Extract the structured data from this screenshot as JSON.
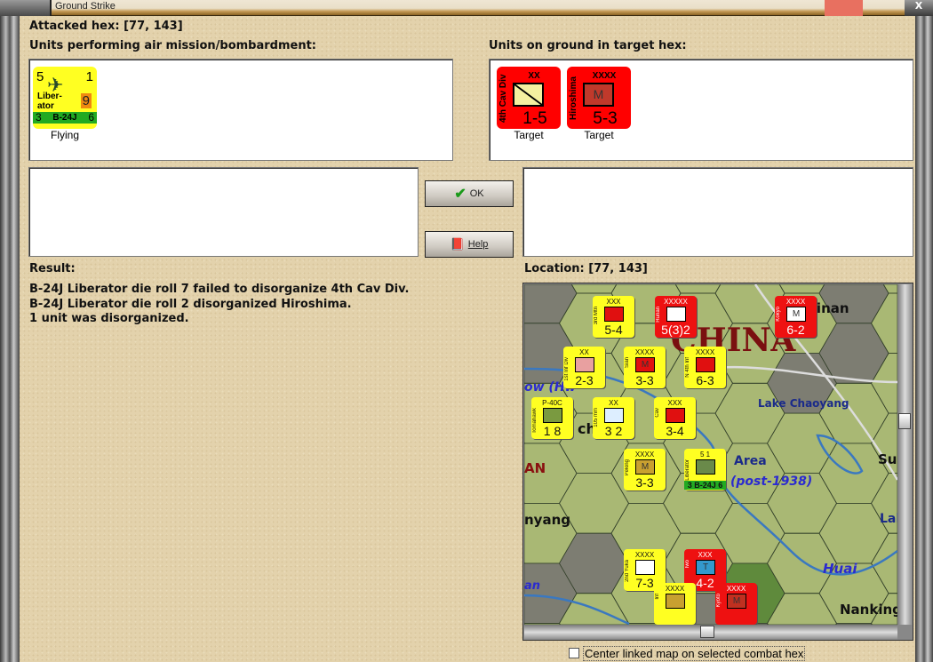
{
  "window": {
    "title": "Ground Strike",
    "close": "X"
  },
  "attacked_hex": "Attacked hex:  [77, 143]",
  "air_units": {
    "label": "Units performing air mission/bombardment:",
    "units": [
      {
        "top_left": "5",
        "top_right": "1",
        "name": "Liber-\nator",
        "value": "9",
        "bottom_left": "3",
        "type": "B-24J",
        "bottom_right": "6",
        "status": "Flying"
      }
    ]
  },
  "ground_units": {
    "label": "Units on ground in target hex:",
    "units": [
      {
        "size": "XX",
        "name": "4th Cav Div",
        "strength": "1-5",
        "status": "Target"
      },
      {
        "size": "XXXX",
        "name": "Hiroshima",
        "symbol": "M",
        "strength": "5-3",
        "status": "Target"
      }
    ]
  },
  "buttons": {
    "ok": "OK",
    "help": "Help"
  },
  "result": {
    "label": "Result:",
    "lines": [
      "B-24J Liberator die roll 7 failed to disorganize 4th Cav Div.",
      "B-24J Liberator die roll 2 disorganized Hiroshima.",
      "1 unit was disorganized."
    ]
  },
  "location": {
    "label": "Location:  [77, 143]"
  },
  "map": {
    "labels": [
      "CHINA",
      "sinan",
      "Lake Chaoyang",
      "Area",
      "v (post-1938)",
      "ow (Hw",
      "ch",
      "AN",
      "nyang",
      "Su",
      "Lak",
      "Huai",
      "an",
      "Nanking"
    ],
    "counters": [
      {
        "size": "XXX",
        "name": "3rd Mtn",
        "strength": "5-4",
        "color": "#ffff22",
        "sym": "#e01010"
      },
      {
        "size": "XXXXX",
        "name": "Hunan",
        "strength": "5(3)2",
        "color": "#ee1111",
        "sym": "#ffffff"
      },
      {
        "size": "XXXX",
        "name": "Kokyo",
        "strength": "6-2",
        "color": "#ee1111",
        "sym": "#ffffff",
        "mark": "M"
      },
      {
        "size": "XX",
        "name": "1st Inf Div",
        "strength": "2-3",
        "color": "#ffff22",
        "sym": "#e8a0a0"
      },
      {
        "size": "XXXX",
        "name": "Sian",
        "strength": "3-3",
        "color": "#ffff22",
        "sym": "#e01010",
        "mark": "M"
      },
      {
        "size": "XXXX",
        "name": "N 4th Inf",
        "strength": "6-3",
        "color": "#ffff22",
        "sym": "#e01010"
      },
      {
        "size": "P-40C",
        "name": "Tomahawk",
        "strength": "1  8",
        "color": "#ffff22",
        "sym": "#7a9a40"
      },
      {
        "size": "XX",
        "name": "105 mm",
        "strength": "3 2",
        "color": "#ffff22",
        "sym": "#ddeeff"
      },
      {
        "size": "XXX",
        "name": "Cav",
        "strength": "3-4",
        "color": "#ffff22",
        "sym": "#e01010"
      },
      {
        "size": "XXXX",
        "name": "Peking",
        "strength": "3-3",
        "color": "#ffff22",
        "sym": "#c8a030",
        "mark": "M"
      },
      {
        "size": "5  1",
        "name": "Liberator",
        "strength": "3 B-24J 6",
        "color": "#ffff22",
        "sym": "#6a8a4a"
      },
      {
        "size": "XXXX",
        "name": "2nd Yuka",
        "strength": "7-3",
        "color": "#ffff22",
        "sym": "#ffffff"
      },
      {
        "size": "XXX",
        "name": "Iwo",
        "strength": "4-2",
        "color": "#ee1111",
        "sym": "#3399cc",
        "mark": "T"
      },
      {
        "size": "XXXX",
        "name": "Inf",
        "strength": "",
        "color": "#ffff22",
        "sym": "#c8a030"
      },
      {
        "size": "XXXX",
        "name": "Kyoto",
        "strength": "",
        "color": "#ee1111",
        "sym": "#c03020",
        "mark": "M"
      }
    ]
  },
  "checkbox": {
    "label": "Center linked map on selected combat hex",
    "checked": false
  }
}
